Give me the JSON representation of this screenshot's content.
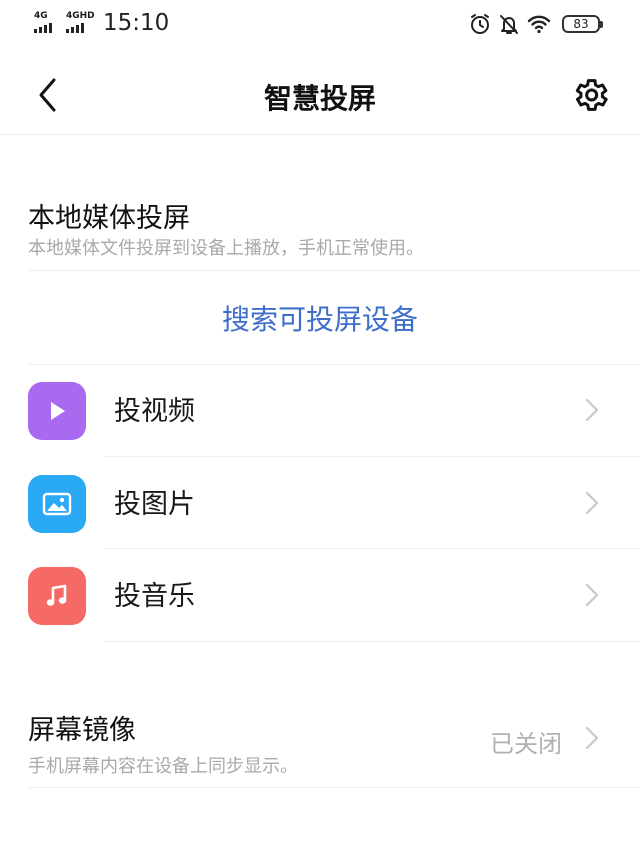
{
  "status_bar": {
    "network1": "4G",
    "network2": "4GHD",
    "time": "15:10",
    "battery": "83",
    "icons": [
      "alarm-icon",
      "mute-icon",
      "wifi-icon",
      "battery-icon"
    ]
  },
  "header": {
    "title": "智慧投屏",
    "back_icon": "back-arrow-icon",
    "settings_icon": "gear-icon"
  },
  "local_media": {
    "title": "本地媒体投屏",
    "subtitle": "本地媒体文件投屏到设备上播放，手机正常使用。",
    "search_label": "搜索可投屏设备"
  },
  "items": [
    {
      "label": "投视频",
      "icon": "play-icon",
      "color": "#a96af0"
    },
    {
      "label": "投图片",
      "icon": "image-icon",
      "color": "#2aa9f5"
    },
    {
      "label": "投音乐",
      "icon": "music-note-icon",
      "color": "#f56a64"
    }
  ],
  "mirroring": {
    "title": "屏幕镜像",
    "subtitle": "手机屏幕内容在设备上同步显示。",
    "status": "已关闭"
  },
  "colors": {
    "accent": "#3e6ecb",
    "muted_text": "#a9a9a9"
  }
}
